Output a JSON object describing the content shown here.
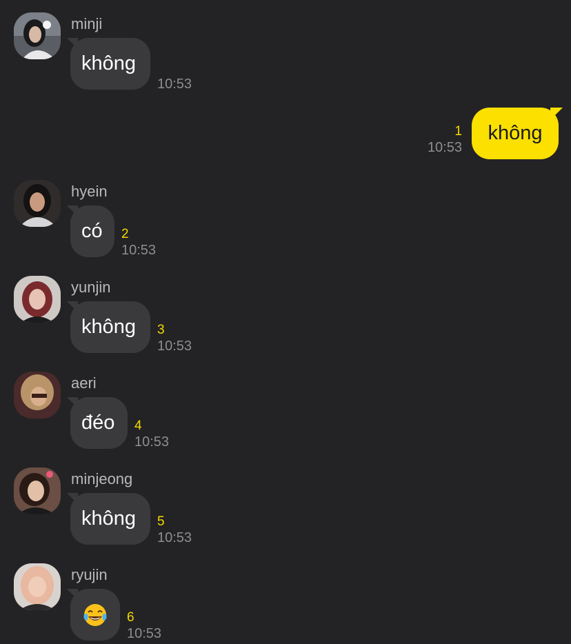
{
  "messages": [
    {
      "sender": "minji",
      "text": "không",
      "unread": "",
      "time": "10:53"
    },
    {
      "sender": "hyein",
      "text": "có",
      "unread": "2",
      "time": "10:53"
    },
    {
      "sender": "yunjin",
      "text": "không",
      "unread": "3",
      "time": "10:53"
    },
    {
      "sender": "aeri",
      "text": "đéo",
      "unread": "4",
      "time": "10:53"
    },
    {
      "sender": "minjeong",
      "text": "không",
      "unread": "5",
      "time": "10:53"
    },
    {
      "sender": "ryujin",
      "emoji": "face-with-tears-of-joy",
      "unread": "6",
      "time": "10:53"
    }
  ],
  "outgoing": {
    "text": "không",
    "unread": "1",
    "time": "10:53"
  },
  "colors": {
    "background": "#232325",
    "incoming_bubble": "#3a3a3d",
    "outgoing_bubble": "#fbe000",
    "unread_count": "#f7d900",
    "timestamp": "#8e8e92"
  }
}
